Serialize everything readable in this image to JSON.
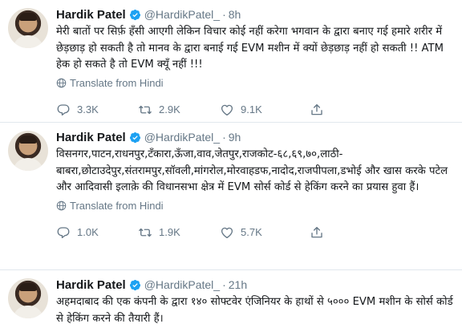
{
  "tweets": [
    {
      "name": "Hardik Patel",
      "handle": "@HardikPatel_",
      "dot": "·",
      "time": "8h",
      "text": "मेरी बातों पर सिर्फ़ हँसी आएगी लेकिन विचार कोई नहीं करेगा भगवान के द्वारा बनाए गई हमारे शरीर में छेड़छाड़ हो सकती है तो मानव के द्वारा बनाई गई EVM मशीन में क्यों छेड़छाड़ नहीं हो सकती !! ATM हेक हो सकते है तो EVM क्यूँ नहीं !!!",
      "translate": "Translate from Hindi",
      "replies": "3.3K",
      "retweets": "2.9K",
      "likes": "9.1K"
    },
    {
      "name": "Hardik Patel",
      "handle": "@HardikPatel_",
      "dot": "·",
      "time": "9h",
      "text": "विसनगर,पाटन,राधनपुर,टँकारा,ऊँजा,वाव,जेतपुर,राजकोट-६८,६९,७०,लाठी-बाबरा,छोटाउदेपुर,संतरामपुर,सॉवली,मांगरोल,मोरवाहडफ,नादोद,राजपीपला,डभोई और खास करके पटेल और आदिवासी इलाक़े की विधानसभा क्षेत्र में EVM सोर्स कोर्ड से हेकिंग करने का प्रयास हुवा हैं।",
      "translate": "Translate from Hindi",
      "replies": "1.0K",
      "retweets": "1.9K",
      "likes": "5.7K"
    },
    {
      "name": "Hardik Patel",
      "handle": "@HardikPatel_",
      "dot": "·",
      "time": "21h",
      "text": "अहमदाबाद की एक कंपनी के द्वारा १४० सोफ्टवेर एंजिनियर के हाथों से ५००० EVM मशीन के सोर्स कोर्ड से हेकिंग करने की तैयारी हैं।"
    }
  ],
  "colors": {
    "verified": "#1da1f2",
    "muted": "#657786",
    "text": "#14171a",
    "divider": "#e1e8ed"
  },
  "icons": {
    "verified": "verified-badge-icon",
    "translate": "globe-icon",
    "reply": "reply-icon",
    "retweet": "retweet-icon",
    "like": "heart-icon"
  }
}
